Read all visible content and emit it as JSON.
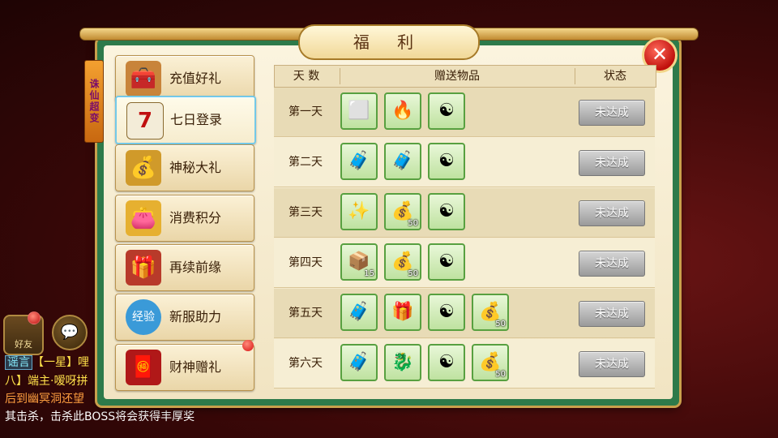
{
  "title": "福 利",
  "side_ribbon": "诛仙超变",
  "close_icon": "x-icon",
  "menu": [
    {
      "label": "充值好礼",
      "icon": "treasure-chest-icon",
      "glyph": "🧰",
      "active": false,
      "dot": false
    },
    {
      "label": "七日登录",
      "icon": "calendar-icon",
      "glyph": "7",
      "active": true,
      "dot": false
    },
    {
      "label": "神秘大礼",
      "icon": "gold-chest-icon",
      "glyph": "💰",
      "active": false,
      "dot": false
    },
    {
      "label": "消费积分",
      "icon": "gold-pouch-icon",
      "glyph": "👛",
      "active": false,
      "dot": false
    },
    {
      "label": "再续前缘",
      "icon": "gift-basket-icon",
      "glyph": "🎁",
      "active": false,
      "dot": false
    },
    {
      "label": "新服助力",
      "icon": "exp-badge-icon",
      "glyph": "经验",
      "active": false,
      "dot": false
    },
    {
      "label": "财神赠礼",
      "icon": "red-envelope-icon",
      "glyph": "🧧",
      "active": false,
      "dot": true
    }
  ],
  "table": {
    "headers": {
      "day": "天 数",
      "items": "赠送物品",
      "status": "状态"
    },
    "rows": [
      {
        "day": "第一天",
        "status": "未达成",
        "items": [
          {
            "icon": "white-box-icon",
            "glyph": "⬜",
            "qty": ""
          },
          {
            "icon": "fire-spirit-icon",
            "glyph": "🔥",
            "qty": ""
          },
          {
            "icon": "yin-yang-icon",
            "glyph": "☯",
            "qty": ""
          }
        ]
      },
      {
        "day": "第二天",
        "status": "未达成",
        "items": [
          {
            "icon": "purple-chest-icon",
            "glyph": "🧳",
            "qty": ""
          },
          {
            "icon": "purple-chest-icon",
            "glyph": "🧳",
            "qty": ""
          },
          {
            "icon": "yin-yang-icon",
            "glyph": "☯",
            "qty": ""
          }
        ]
      },
      {
        "day": "第三天",
        "status": "未达成",
        "items": [
          {
            "icon": "blue-wings-icon",
            "glyph": "✨",
            "qty": ""
          },
          {
            "icon": "gold-chest-icon",
            "glyph": "💰",
            "qty": "50"
          },
          {
            "icon": "yin-yang-icon",
            "glyph": "☯",
            "qty": ""
          }
        ]
      },
      {
        "day": "第四天",
        "status": "未达成",
        "items": [
          {
            "icon": "dark-chest-icon",
            "glyph": "📦",
            "qty": "15"
          },
          {
            "icon": "gold-chest-icon",
            "glyph": "💰",
            "qty": "50"
          },
          {
            "icon": "yin-yang-icon",
            "glyph": "☯",
            "qty": ""
          }
        ]
      },
      {
        "day": "第五天",
        "status": "未达成",
        "items": [
          {
            "icon": "purple-chest-icon",
            "glyph": "🧳",
            "qty": ""
          },
          {
            "icon": "blue-gift-box-icon",
            "glyph": "🎁",
            "qty": ""
          },
          {
            "icon": "yin-yang-icon",
            "glyph": "☯",
            "qty": ""
          },
          {
            "icon": "gold-chest-icon",
            "glyph": "💰",
            "qty": "50"
          }
        ]
      },
      {
        "day": "第六天",
        "status": "未达成",
        "items": [
          {
            "icon": "purple-chest-icon",
            "glyph": "🧳",
            "qty": ""
          },
          {
            "icon": "spirit-pet-icon",
            "glyph": "🐉",
            "qty": ""
          },
          {
            "icon": "yin-yang-icon",
            "glyph": "☯",
            "qty": ""
          },
          {
            "icon": "gold-chest-icon",
            "glyph": "💰",
            "qty": "50"
          }
        ]
      }
    ]
  },
  "chat": {
    "friend_label": "好友",
    "lines": [
      {
        "tag": "谣言",
        "text": "【一星】哩"
      },
      {
        "tag": "",
        "text": "八】端主·嗳呀拼"
      },
      {
        "tag": "",
        "text": "后到幽冥洞还望"
      },
      {
        "tag": "",
        "text": "其击杀，击杀此BOSS将会获得丰厚奖"
      }
    ]
  },
  "colors": {
    "accent": "#c9a04c",
    "frame_green": "#2d7a4a",
    "item_border": "#58a040",
    "status_gray": "#9a9a9a"
  }
}
